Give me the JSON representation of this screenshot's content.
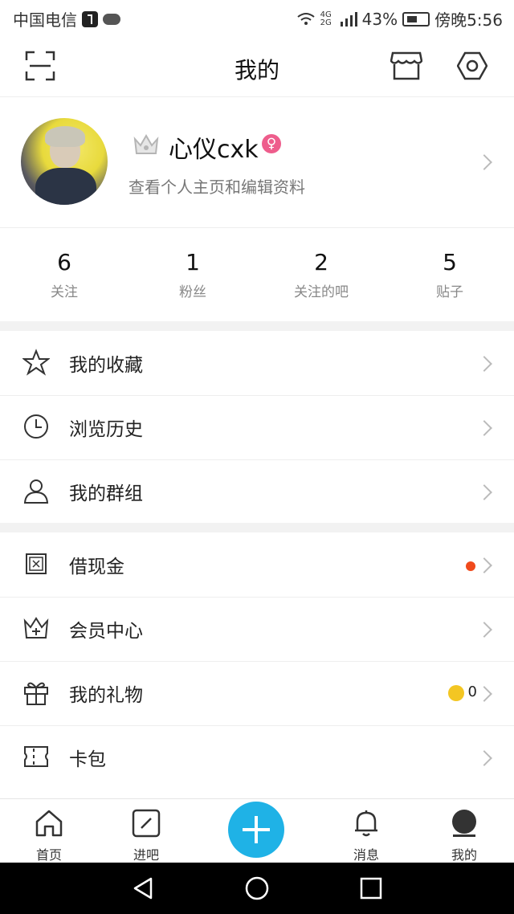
{
  "status_bar": {
    "carrier": "中国电信",
    "signal": "4G 2G",
    "battery": "43%",
    "time": "傍晚5:56"
  },
  "header": {
    "title": "我的"
  },
  "profile": {
    "username": "心仪cxk",
    "subtitle": "查看个人主页和编辑资料"
  },
  "stats": [
    {
      "value": "6",
      "label": "关注"
    },
    {
      "value": "1",
      "label": "粉丝"
    },
    {
      "value": "2",
      "label": "关注的吧"
    },
    {
      "value": "5",
      "label": "贴子"
    }
  ],
  "menu": {
    "favorites": "我的收藏",
    "history": "浏览历史",
    "groups": "我的群组",
    "cash": "借现金",
    "vip": "会员中心",
    "gifts": "我的礼物",
    "gifts_count": "0",
    "wallet": "卡包"
  },
  "tabs": {
    "home": "首页",
    "bar": "进吧",
    "messages": "消息",
    "me": "我的"
  },
  "colors": {
    "accent": "#1fb2e6",
    "notice_dot": "#f04a1c",
    "coin": "#f3c623"
  }
}
